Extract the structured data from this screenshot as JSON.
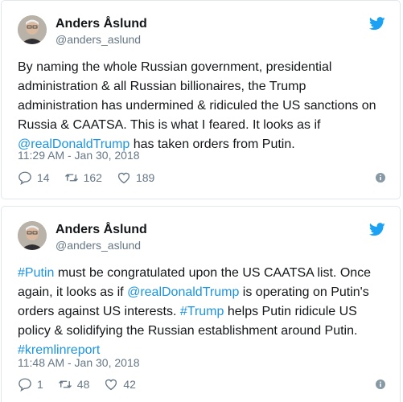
{
  "colors": {
    "link": "#1b95e0",
    "muted": "#657786",
    "text": "#14171a",
    "border": "#e1e8ed",
    "twitter_blue": "#1da1f2"
  },
  "tweets": [
    {
      "name": "Anders Åslund",
      "handle": "@anders_aslund",
      "text_lines": [
        "By naming the whole Russian government, presidential",
        "administration & all Russian billionaires, the Trump",
        "administration has undermined & ridiculed the US sanctions on",
        "Russia & CAATSA. This is what I feared. It looks as if"
      ],
      "mention": "@realDonaldTrump",
      "last_line_rest": " has taken orders from Putin.",
      "timestamp": "11:29 AM - Jan 30, 2018",
      "replies": "14",
      "retweets": "162",
      "likes": "189"
    },
    {
      "name": "Anders Åslund",
      "handle": "@anders_aslund",
      "l1_tag": "#Putin",
      "l1_rest": " must be congratulated upon the US CAATSA list. Once",
      "l2_start": "again, it looks as if ",
      "l2_mention": "@realDonaldTrump",
      "l2_rest": " is operating on Putin's",
      "l3_start": "orders against US interests. ",
      "l3_tag": "#Trump",
      "l3_rest": " helps Putin ridicule US",
      "l4": "policy & solidifying the Russian establishment around Putin.",
      "l5_tag": "#kremlinreport",
      "timestamp": "11:48 AM - Jan 30, 2018",
      "replies": "1",
      "retweets": "48",
      "likes": "42"
    }
  ],
  "icons": {
    "avatar": "avatar-photo",
    "brand": "twitter-bird-icon",
    "reply": "reply-icon",
    "retweet": "retweet-icon",
    "like": "heart-icon",
    "info": "info-icon"
  }
}
